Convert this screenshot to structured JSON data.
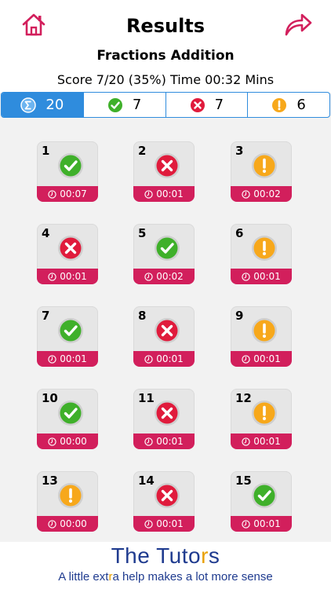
{
  "header": {
    "title": "Results",
    "subtitle": "Fractions Addition",
    "score_line": "Score 7/20  (35%) Time 00:32 Mins"
  },
  "summary": [
    {
      "name": "total",
      "icon": "sigma-icon",
      "count": "20"
    },
    {
      "name": "correct",
      "icon": "check-circle-icon",
      "count": "7"
    },
    {
      "name": "wrong",
      "icon": "x-circle-icon",
      "count": "7"
    },
    {
      "name": "skipped",
      "icon": "exclamation-circle-icon",
      "count": "6"
    }
  ],
  "questions": [
    {
      "number": "1",
      "status": "correct",
      "time": "00:07"
    },
    {
      "number": "2",
      "status": "wrong",
      "time": "00:01"
    },
    {
      "number": "3",
      "status": "skipped",
      "time": "00:02"
    },
    {
      "number": "4",
      "status": "wrong",
      "time": "00:01"
    },
    {
      "number": "5",
      "status": "correct",
      "time": "00:02"
    },
    {
      "number": "6",
      "status": "skipped",
      "time": "00:01"
    },
    {
      "number": "7",
      "status": "correct",
      "time": "00:01"
    },
    {
      "number": "8",
      "status": "wrong",
      "time": "00:01"
    },
    {
      "number": "9",
      "status": "skipped",
      "time": "00:01"
    },
    {
      "number": "10",
      "status": "correct",
      "time": "00:00"
    },
    {
      "number": "11",
      "status": "wrong",
      "time": "00:01"
    },
    {
      "number": "12",
      "status": "skipped",
      "time": "00:01"
    },
    {
      "number": "13",
      "status": "skipped",
      "time": "00:00"
    },
    {
      "number": "14",
      "status": "wrong",
      "time": "00:01"
    },
    {
      "number": "15",
      "status": "correct",
      "time": "00:01"
    }
  ],
  "footer": {
    "logo_pre": "The Tuto",
    "logo_mid": "r",
    "logo_post": "s",
    "tagline_pre": "A little ext",
    "tagline_mid": "r",
    "tagline_post": "a help makes a lot more sense"
  },
  "colors": {
    "accent_blue": "#2f8cdd",
    "brand_red": "#d21f5c",
    "correct": "#3fb02a",
    "wrong": "#e01b3c",
    "skipped": "#f7a81b",
    "logo_blue": "#1f3b8f",
    "logo_orange": "#e8a000"
  }
}
